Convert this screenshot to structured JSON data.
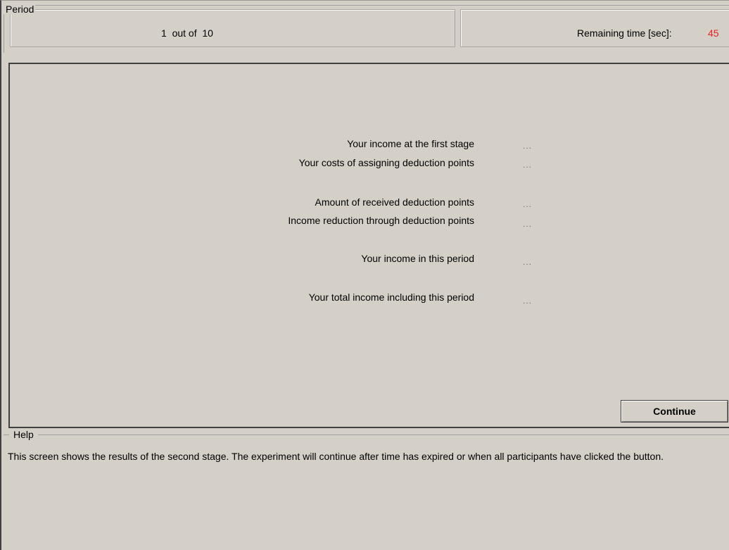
{
  "period": {
    "title": "Period",
    "counter": "1  out of  10",
    "remaining_label": "Remaining time [sec]:",
    "remaining_value": "45"
  },
  "results": {
    "rows": [
      {
        "label": "Your income at the first stage",
        "value": "..."
      },
      {
        "label": "Your costs of assigning deduction points",
        "value": "..."
      },
      {
        "label": "Amount of received deduction points",
        "value": "..."
      },
      {
        "label": "Income reduction through deduction points",
        "value": "..."
      },
      {
        "label": "Your income in this period",
        "value": "..."
      },
      {
        "label": "Your total income including this period",
        "value": "..."
      }
    ],
    "continue_label": "Continue"
  },
  "help": {
    "title": "Help",
    "text": "This screen shows the results of the second stage. The experiment will continue after time has expired or when all participants have clicked the button."
  },
  "colors": {
    "background": "#d4d0c8",
    "remaining_value": "#e82020"
  }
}
